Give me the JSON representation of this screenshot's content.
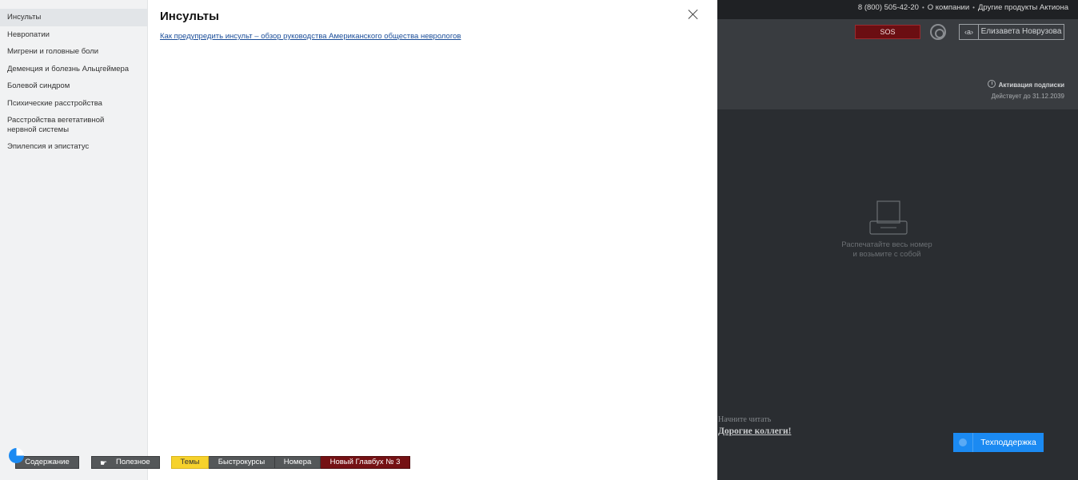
{
  "topbar": {
    "phone": "8 (800) 505-42-20",
    "about": "О компании",
    "products": "Другие продукты Актиона"
  },
  "header": {
    "sos_label": "SOS",
    "user_initial": "‹а›",
    "user_name": "Елизавета Новрузова",
    "subscription_label": "Активация подписки",
    "subscription_until": "Действует до  31.12.2039"
  },
  "content": {
    "print_note_line1": "Распечатайте весь номер",
    "print_note_line2": "и возьмите с собой",
    "read_label": "Начните читать",
    "read_link": "Дорогие коллеги!"
  },
  "support": {
    "label": "Техподдержка"
  },
  "sidebar": {
    "items": [
      {
        "label": "Инсульты",
        "active": true
      },
      {
        "label": "Невропатии"
      },
      {
        "label": "Мигрени и головные боли"
      },
      {
        "label": "Деменция и болезнь Альцгеймера"
      },
      {
        "label": "Болевой синдром"
      },
      {
        "label": "Психические расстройства"
      },
      {
        "label": "Расстройства вегетативной нервной системы"
      },
      {
        "label": "Эпилепсия и эпистатус"
      }
    ]
  },
  "modal": {
    "title": "Инсульты",
    "article_link": "Как предупредить инсульт – обзор руководства Американского общества неврологов"
  },
  "toolbar": {
    "toc_label": "Содержание",
    "useful_label": "Полезное",
    "tabs": [
      {
        "label": "Темы",
        "active": true
      },
      {
        "label": "Быстрокурсы"
      },
      {
        "label": "Номера"
      },
      {
        "label": "Новый Главбух № 3"
      }
    ]
  },
  "colors": {
    "accent_blue": "#1b8af2",
    "sos_red": "#6b0e12",
    "active_tab_yellow": "#f6d22c",
    "issue_tab_red": "#751114"
  }
}
